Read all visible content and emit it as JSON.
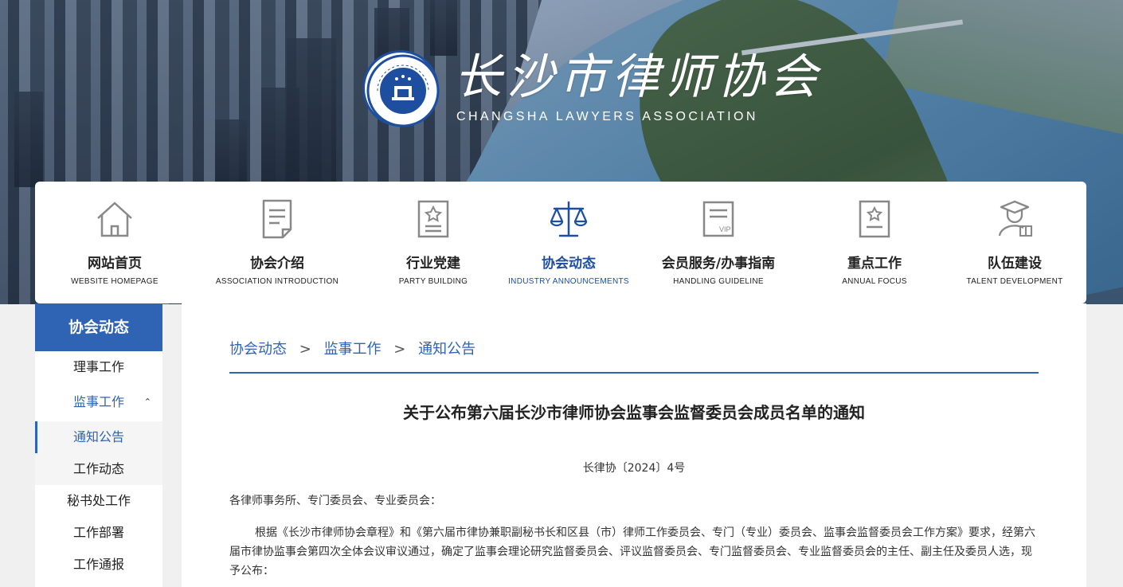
{
  "header": {
    "logo_title": "长沙市律师协会",
    "logo_subtitle": "CHANGSHA LAWYERS ASSOCIATION",
    "seal_text": "长沙市律师协会 · CHANGSHA LAWYERS ASSOCIATION"
  },
  "nav": {
    "items": [
      {
        "label": "网站首页",
        "sub": "WEBSITE HOMEPAGE",
        "icon": "house-icon"
      },
      {
        "label": "协会介绍",
        "sub": "ASSOCIATION INTRODUCTION",
        "icon": "document-icon"
      },
      {
        "label": "行业党建",
        "sub": "PARTY BUILDING",
        "icon": "party-badge-icon"
      },
      {
        "label": "协会动态",
        "sub": "INDUSTRY ANNOUNCEMENTS",
        "icon": "scales-icon",
        "active": true
      },
      {
        "label": "会员服务/办事指南",
        "sub": "HANDLING GUIDELINE",
        "icon": "vip-card-icon"
      },
      {
        "label": "重点工作",
        "sub": "ANNUAL FOCUS",
        "icon": "certificate-icon"
      },
      {
        "label": "队伍建设",
        "sub": "TALENT DEVELOPMENT",
        "icon": "graduate-icon"
      }
    ],
    "active_color": "#1d4ea0"
  },
  "sidebar": {
    "title": "协会动态",
    "items": [
      {
        "label": "理事工作"
      },
      {
        "label": "监事工作",
        "open": true,
        "caret": "⌃"
      },
      {
        "label": "秘书处工作"
      },
      {
        "label": "工作部署"
      },
      {
        "label": "工作通报"
      }
    ],
    "subitems": [
      {
        "label": "通知公告",
        "current": true
      },
      {
        "label": "工作动态"
      }
    ],
    "accent": "#2f63b4"
  },
  "breadcrumb": {
    "items": [
      "协会动态",
      "监事工作",
      "通知公告"
    ],
    "separator": ">"
  },
  "article": {
    "title": "关于公布第六届长沙市律师协会监事会监督委员会成员名单的通知",
    "doc_no": "长律协〔2024〕4号",
    "salutation": "各律师事务所、专门委员会、专业委员会：",
    "body": "根据《长沙市律师协会章程》和《第六届市律协兼职副秘书长和区县（市）律师工作委员会、专门（专业）委员会、监事会监督委员会工作方案》要求，经第六届市律协监事会第四次全体会议审议通过，确定了监事会理论研究监督委员会、评议监督委员会、专门监督委员会、专业监督委员会的主任、副主任及委员人选，现予公布："
  }
}
